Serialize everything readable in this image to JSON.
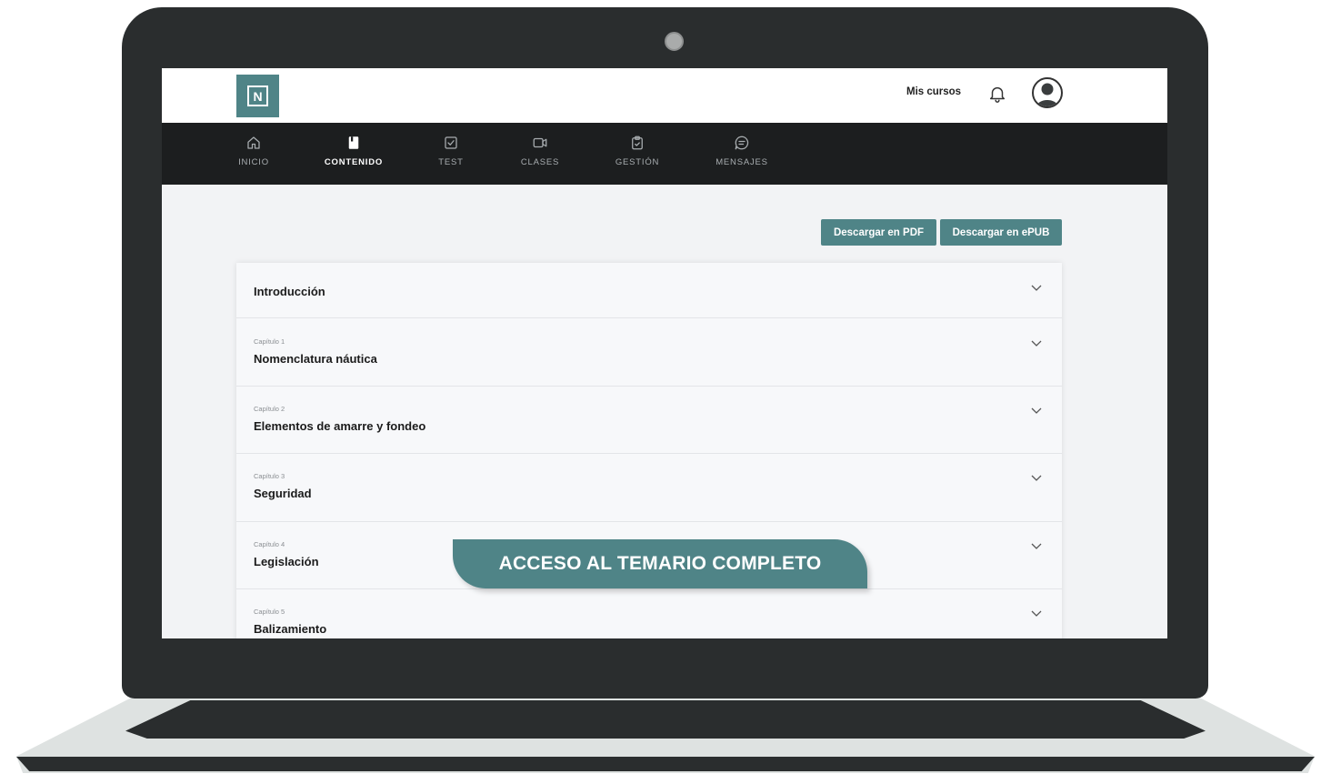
{
  "header": {
    "logo_letter": "N",
    "my_courses": "Mis cursos"
  },
  "nav": {
    "items": [
      {
        "label": "INICIO",
        "icon": "home-icon"
      },
      {
        "label": "CONTENIDO",
        "icon": "book-icon",
        "active": true
      },
      {
        "label": "TEST",
        "icon": "checkbox-icon"
      },
      {
        "label": "CLASES",
        "icon": "video-icon"
      },
      {
        "label": "GESTIÓN",
        "icon": "clipboard-icon"
      },
      {
        "label": "MENSAJES",
        "icon": "chat-icon"
      }
    ]
  },
  "downloads": {
    "pdf": "Descargar en PDF",
    "epub": "Descargar en ePUB"
  },
  "accordion": {
    "items": [
      {
        "chapter": "",
        "title": "Introducción"
      },
      {
        "chapter": "Capítulo 1",
        "title": "Nomenclatura náutica"
      },
      {
        "chapter": "Capítulo 2",
        "title": "Elementos de amarre y fondeo"
      },
      {
        "chapter": "Capítulo 3",
        "title": "Seguridad"
      },
      {
        "chapter": "Capítulo 4",
        "title": "Legislación"
      },
      {
        "chapter": "Capítulo 5",
        "title": "Balizamiento"
      }
    ]
  },
  "banner": {
    "text": "ACCESO AL TEMARIO COMPLETO"
  },
  "colors": {
    "accent": "#4f8487",
    "nav_bg": "#1c1e1f",
    "laptop": "#2a2d2e"
  }
}
